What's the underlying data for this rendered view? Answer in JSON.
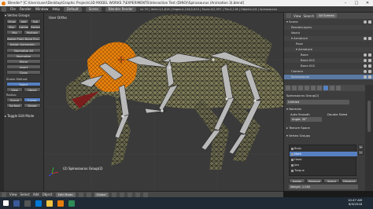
{
  "window": {
    "title": "Blender* [C:\\Users\\user\\Desktop\\Graphic Projects\\3D MODEL WORKS 7\\EXPERIMENTS\\Interaction Test (DINO)\\Spinosaurus (Animation 3).blend]",
    "minimize": "–",
    "maximize": "□",
    "close": "✕"
  },
  "menubar": {
    "items": [
      "File",
      "Render",
      "Window",
      "Help"
    ],
    "layout": "Default",
    "scene": "Scene",
    "engine": "Blender Render",
    "version_info": "v2.79 | Verts:1/1,816 | Edges:4,104/2,810 | Faces:0/2,997 | Tris:4,116 | Objects:1/4 | Spinosaurus"
  },
  "toolpanel": {
    "vertex_groups_header": "▾ Vertex Groups",
    "buttons": {
      "draw": "Draw",
      "add": "Add",
      "sub": "Sub",
      "blur": "Blur",
      "lighten": "Lighten",
      "darken": "Darken",
      "mix": "Mix",
      "multiply": "Multiply",
      "assign_from_bone_envelopes": "Assign From Bone Env...",
      "assign_automatic": "Assign Automatic...",
      "normalize_all": "Normalize All",
      "normalize": "Normalize",
      "mirror": "Mirror",
      "invert": "Invert",
      "clean": "Clean",
      "quantize": "Quantize",
      "levels": "Levels",
      "smooth": "Smooth",
      "limit_total": "Limit Total",
      "fix_deforms": "Fix Deforms",
      "transfer_weights": "Transfer Weights"
    },
    "stroke_method_header": "Stroke Method:",
    "stroke_method": "Space",
    "spacing_label": "Spacing",
    "project_label": "Project",
    "radius_label": "Radius:",
    "view_btn": "View",
    "scene_btn": "Scene",
    "object_btn": "Object",
    "surface_btn": "Surface",
    "stroke_btn": "Stroke",
    "cursor_btn": "Cursor",
    "adjust_header": "▸ Toggle Edit Mode"
  },
  "viewport": {
    "label": "User Ortho",
    "footer": "(2) Spinosaurus Group(2)"
  },
  "viewheader": {
    "items": [
      "View",
      "Select",
      "Add",
      "Object"
    ],
    "mode": "Edit Mode",
    "pivot": "Global",
    "coord": "Global"
  },
  "outliner": {
    "header_items": [
      "View",
      "Search",
      "All Scenes"
    ],
    "rows": [
      {
        "label": "▾ Scene",
        "indent": 0
      },
      {
        "label": "RenderLayers",
        "indent": 1
      },
      {
        "label": "World",
        "indent": 1
      },
      {
        "label": "▾ Armature",
        "indent": 1
      },
      {
        "label": "Pose",
        "indent": 2
      },
      {
        "label": "▾ Armature",
        "indent": 2
      },
      {
        "label": "Bone",
        "indent": 3
      },
      {
        "label": "Bone.001",
        "indent": 3
      },
      {
        "label": "Bone.002",
        "indent": 3
      },
      {
        "label": "Camera",
        "indent": 1
      },
      {
        "label": "Spinosaurus",
        "indent": 1
      }
    ]
  },
  "properties": {
    "object_name": "Untitled",
    "spinosaurus_group": "Spinosaurus Group(2)",
    "section_normals": "▾ Normals",
    "auto_smooth": "Auto Smooth",
    "double_sided": "Double Sided",
    "angle": "Angle: 30°",
    "section_texture_space": "▸ Texture Space",
    "section_vertex_groups": "▾ Vertex Groups",
    "vertex_groups": [
      {
        "name": "Body",
        "selected": false
      },
      {
        "name": "Neck",
        "selected": true
      },
      {
        "name": "Head",
        "selected": false
      },
      {
        "name": "Jaw",
        "selected": false
      },
      {
        "name": "Tongue",
        "selected": false
      }
    ],
    "assign": "Assign",
    "remove": "Remove",
    "select": "Select",
    "deselect": "Deselect",
    "weight_label": "Weight: 1.000"
  },
  "tray": {
    "time": "10:47 AM",
    "date": "6/3/2018"
  },
  "colors": {
    "accent": "#5680c2",
    "orange_selection": "#e8820e",
    "taskbar": "#1f2a36"
  }
}
